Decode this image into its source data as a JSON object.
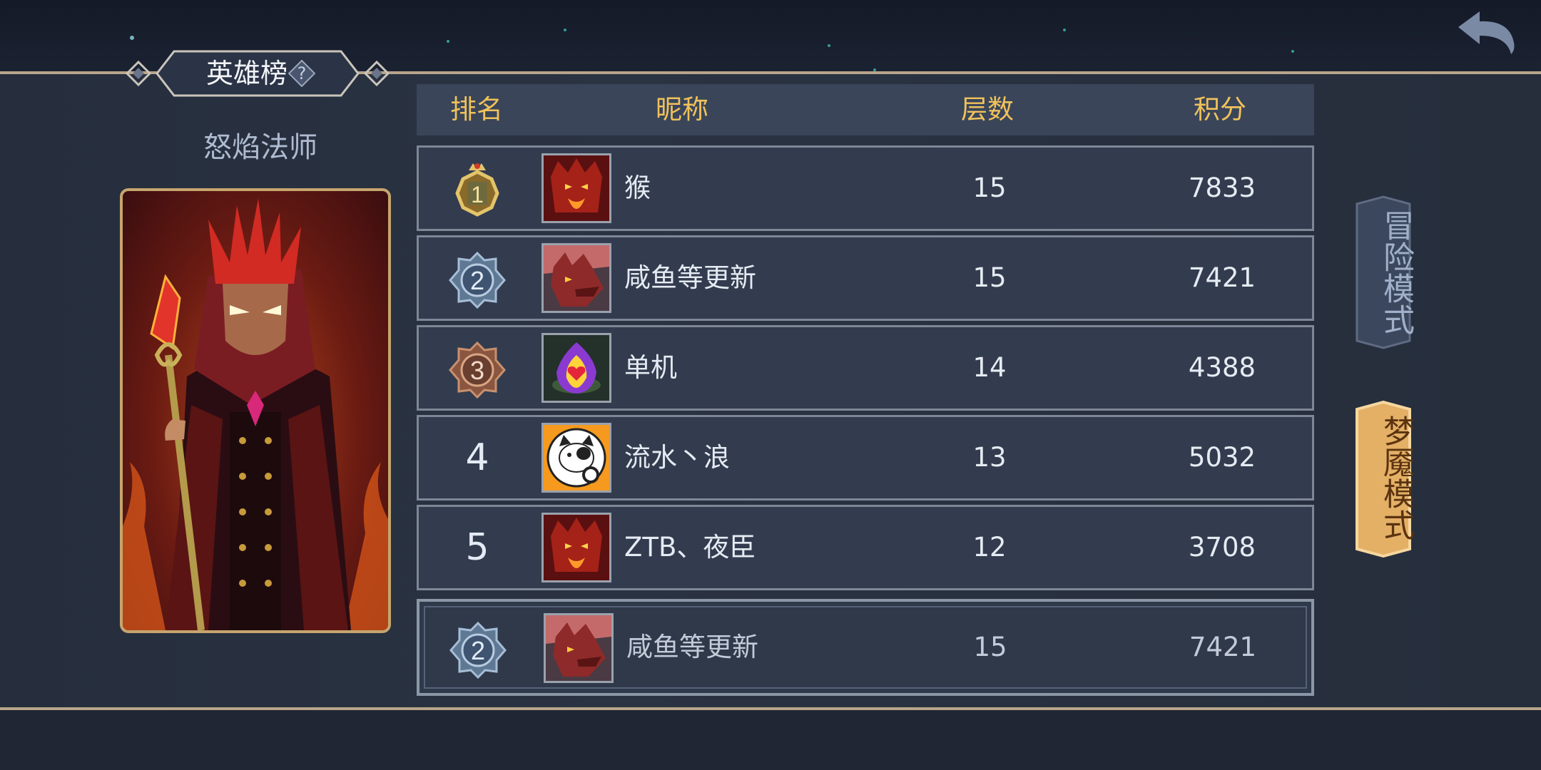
{
  "header": {
    "title": "英雄榜",
    "help_symbol": "?"
  },
  "hero": {
    "name": "怒焰法师"
  },
  "table": {
    "columns": {
      "rank": "排名",
      "nickname": "昵称",
      "floor": "层数",
      "score": "积分"
    },
    "rows": [
      {
        "rank": "1",
        "nickname": "猴",
        "floor": "15",
        "score": "7833",
        "avatar_icon": "fire-demon-avatar"
      },
      {
        "rank": "2",
        "nickname": "咸鱼等更新",
        "floor": "15",
        "score": "7421",
        "avatar_icon": "dragon-avatar"
      },
      {
        "rank": "3",
        "nickname": "单机",
        "floor": "14",
        "score": "4388",
        "avatar_icon": "heart-flame-avatar"
      },
      {
        "rank": "4",
        "nickname": "流水丶浪",
        "floor": "13",
        "score": "5032",
        "avatar_icon": "cat-avatar"
      },
      {
        "rank": "5",
        "nickname": "ZTB、夜臣",
        "floor": "12",
        "score": "3708",
        "avatar_icon": "fire-demon-avatar"
      }
    ],
    "self_row": {
      "rank": "2",
      "nickname": "咸鱼等更新",
      "floor": "15",
      "score": "7421",
      "avatar_icon": "dragon-avatar"
    }
  },
  "modes": {
    "adventure": "冒险模式",
    "nightmare": "梦魇模式"
  },
  "colors": {
    "header_text": "#f0c25b",
    "gold_medal": "#c9a24a",
    "silver_medal": "#7f9ab8",
    "bronze_medal": "#a86a4c",
    "nightmare_button": "#e4b066",
    "adventure_button": "#3b475c"
  }
}
